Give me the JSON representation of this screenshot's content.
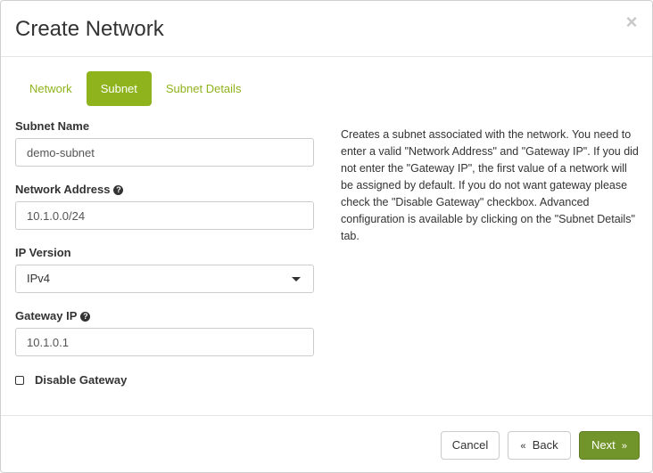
{
  "modal": {
    "title": "Create Network",
    "close_symbol": "×"
  },
  "tabs": [
    {
      "label": "Network",
      "active": false
    },
    {
      "label": "Subnet",
      "active": true
    },
    {
      "label": "Subnet Details",
      "active": false
    }
  ],
  "form": {
    "subnet_name": {
      "label": "Subnet Name",
      "value": "demo-subnet"
    },
    "network_address": {
      "label": "Network Address",
      "value": "10.1.0.0/24",
      "help_icon": "?"
    },
    "ip_version": {
      "label": "IP Version",
      "selected": "IPv4"
    },
    "gateway_ip": {
      "label": "Gateway IP",
      "value": "10.1.0.1",
      "help_icon": "?"
    },
    "disable_gateway": {
      "label": "Disable Gateway",
      "checked": false
    }
  },
  "help_text": "Creates a subnet associated with the network. You need to enter a valid \"Network Address\" and \"Gateway IP\". If you did not enter the \"Gateway IP\", the first value of a network will be assigned by default. If you do not want gateway please check the \"Disable Gateway\" checkbox. Advanced configuration is available by clicking on the \"Subnet Details\" tab.",
  "footer": {
    "cancel_label": "Cancel",
    "back_label": "Back",
    "back_chevron": "«",
    "next_label": "Next",
    "next_chevron": "»"
  },
  "colors": {
    "accent": "#8fb31d",
    "primary_button": "#72952b"
  }
}
